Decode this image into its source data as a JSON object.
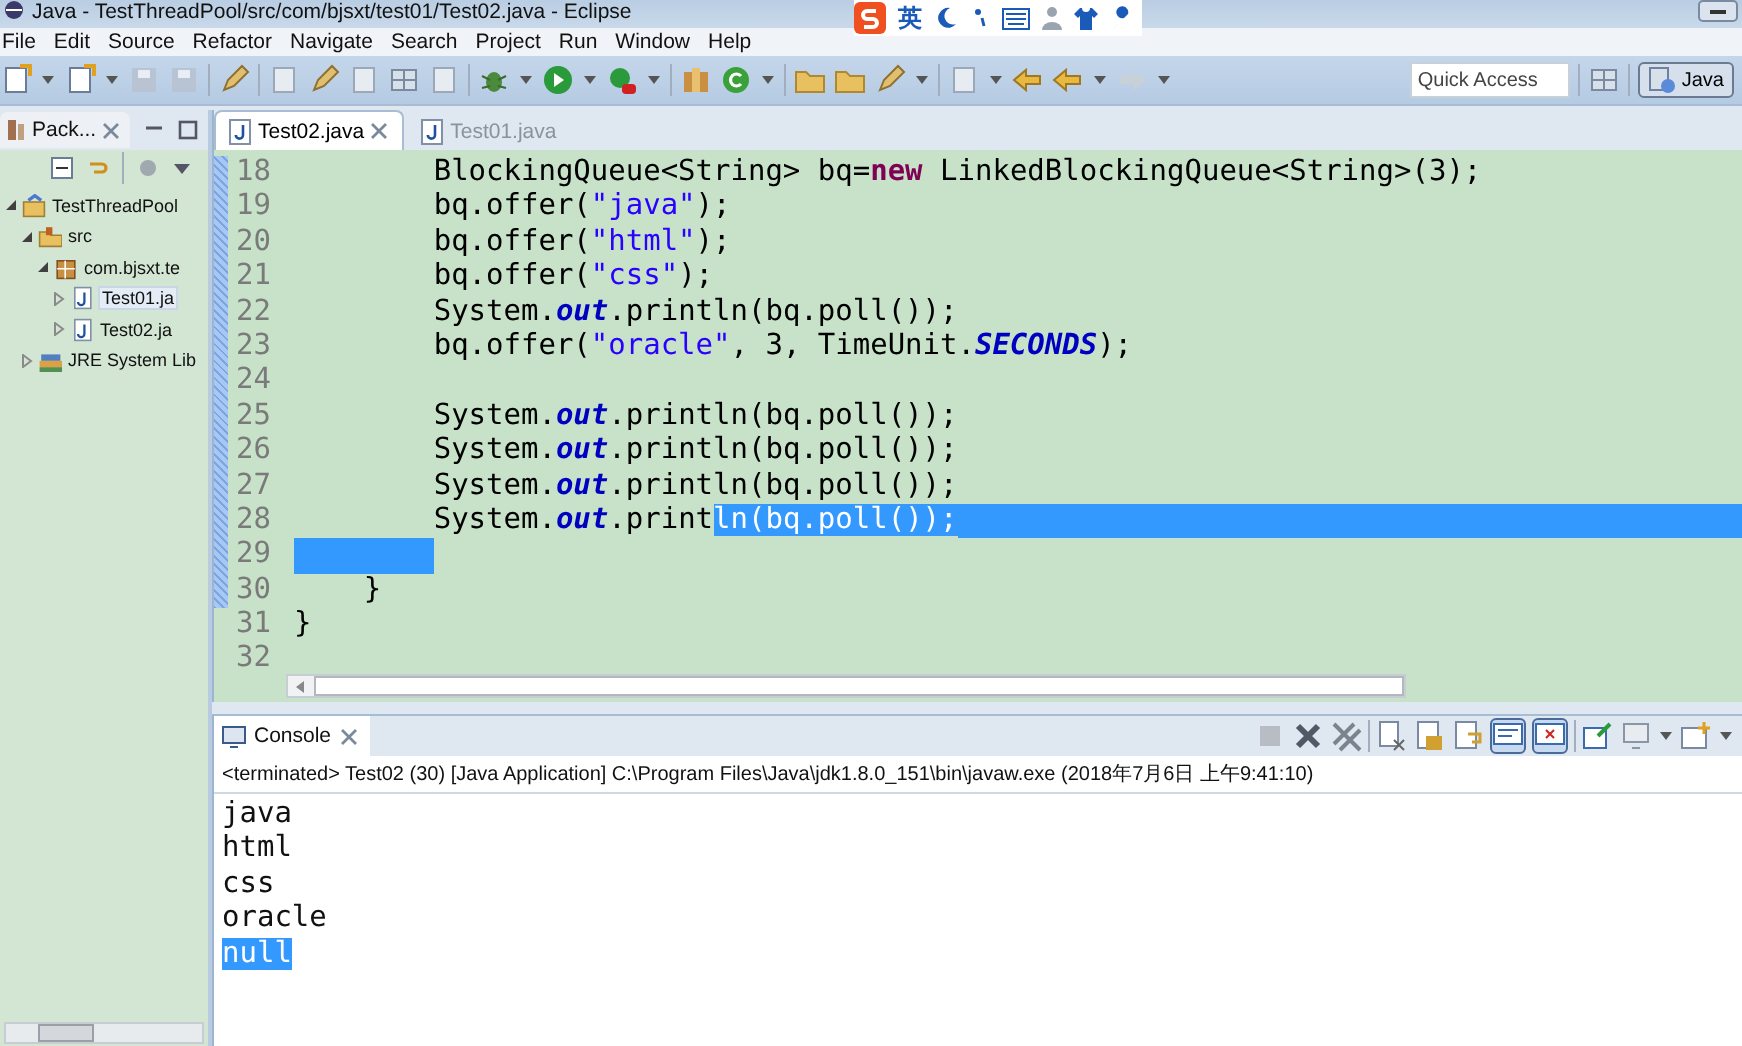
{
  "window": {
    "title": "Java - TestThreadPool/src/com/bjsxt/test01/Test02.java - Eclipse"
  },
  "ime_bar": {
    "label": "英"
  },
  "menu": [
    "File",
    "Edit",
    "Source",
    "Refactor",
    "Navigate",
    "Search",
    "Project",
    "Run",
    "Window",
    "Help"
  ],
  "quick_access": {
    "placeholder": "Quick Access"
  },
  "perspectives": [
    {
      "label": "Java",
      "selected": true
    }
  ],
  "package_explorer": {
    "title": "Pack...",
    "tree": [
      {
        "label": "TestThreadPool",
        "kind": "project",
        "expanded": true,
        "selected": false,
        "children": [
          {
            "label": "src",
            "kind": "source-folder",
            "expanded": true,
            "selected": false,
            "children": [
              {
                "label": "com.bjsxt.te",
                "kind": "package",
                "expanded": true,
                "selected": false,
                "children": [
                  {
                    "label": "Test01.ja",
                    "kind": "java-file",
                    "expanded": false,
                    "selected": true
                  },
                  {
                    "label": "Test02.ja",
                    "kind": "java-file",
                    "expanded": false,
                    "selected": false
                  }
                ]
              }
            ]
          },
          {
            "label": "JRE System Lib",
            "kind": "library",
            "expanded": false,
            "selected": false
          }
        ]
      }
    ]
  },
  "editor": {
    "tabs": [
      {
        "label": "Test02.java",
        "selected": true
      },
      {
        "label": "Test01.java",
        "selected": false
      }
    ],
    "lines": [
      {
        "number": "18",
        "tokens": [
          {
            "kind": "plain",
            "text": "        BlockingQueue<String> bq=",
            "selected": false
          },
          {
            "kind": "keyword",
            "text": "new",
            "selected": false
          },
          {
            "kind": "plain",
            "text": " LinkedBlockingQueue<String>(3);",
            "selected": false
          }
        ]
      },
      {
        "number": "19",
        "tokens": [
          {
            "kind": "plain",
            "text": "        bq.offer(",
            "selected": false
          },
          {
            "kind": "string",
            "text": "\"java\"",
            "selected": false
          },
          {
            "kind": "plain",
            "text": ");",
            "selected": false
          }
        ]
      },
      {
        "number": "20",
        "tokens": [
          {
            "kind": "plain",
            "text": "        bq.offer(",
            "selected": false
          },
          {
            "kind": "string",
            "text": "\"html\"",
            "selected": false
          },
          {
            "kind": "plain",
            "text": ");",
            "selected": false
          }
        ]
      },
      {
        "number": "21",
        "tokens": [
          {
            "kind": "plain",
            "text": "        bq.offer(",
            "selected": false
          },
          {
            "kind": "string",
            "text": "\"css\"",
            "selected": false
          },
          {
            "kind": "plain",
            "text": ");",
            "selected": false
          }
        ]
      },
      {
        "number": "22",
        "tokens": [
          {
            "kind": "plain",
            "text": "        System.",
            "selected": false
          },
          {
            "kind": "static",
            "text": "out",
            "selected": false
          },
          {
            "kind": "plain",
            "text": ".println(bq.poll());",
            "selected": false
          }
        ]
      },
      {
        "number": "23",
        "tokens": [
          {
            "kind": "plain",
            "text": "        bq.offer(",
            "selected": false
          },
          {
            "kind": "string",
            "text": "\"oracle\"",
            "selected": false
          },
          {
            "kind": "plain",
            "text": ", 3, TimeUnit.",
            "selected": false
          },
          {
            "kind": "static",
            "text": "SECONDS",
            "selected": false
          },
          {
            "kind": "plain",
            "text": ");",
            "selected": false
          }
        ]
      },
      {
        "number": "24"
      },
      {
        "number": "25",
        "tokens": [
          {
            "kind": "plain",
            "text": "        System.",
            "selected": false
          },
          {
            "kind": "static",
            "text": "out",
            "selected": false
          },
          {
            "kind": "plain",
            "text": ".println(bq.poll());",
            "selected": false
          }
        ]
      },
      {
        "number": "26",
        "tokens": [
          {
            "kind": "plain",
            "text": "        System.",
            "selected": false
          },
          {
            "kind": "static",
            "text": "out",
            "selected": false
          },
          {
            "kind": "plain",
            "text": ".println(bq.poll());",
            "selected": false
          }
        ]
      },
      {
        "number": "27",
        "tokens": [
          {
            "kind": "plain",
            "text": "        System.",
            "selected": false
          },
          {
            "kind": "static",
            "text": "out",
            "selected": false
          },
          {
            "kind": "plain",
            "text": ".println(bq.poll());",
            "selected": false
          }
        ]
      },
      {
        "number": "28",
        "selected_to_end": true,
        "tokens": [
          {
            "kind": "plain",
            "text": "        System.",
            "selected": false
          },
          {
            "kind": "static",
            "text": "out",
            "selected": false
          },
          {
            "kind": "plain",
            "text": ".print",
            "selected": false
          },
          {
            "kind": "plain",
            "text": "ln(bq.poll());",
            "selected": true
          }
        ]
      },
      {
        "number": "29",
        "leading_selection": true
      },
      {
        "number": "30",
        "tokens": [
          {
            "kind": "plain",
            "text": "    }",
            "selected": false
          }
        ]
      },
      {
        "number": "31",
        "tokens": [
          {
            "kind": "plain",
            "text": "}",
            "selected": false
          }
        ]
      },
      {
        "number": "32"
      }
    ]
  },
  "console": {
    "title": "Console",
    "info": "<terminated> Test02 (30) [Java Application] C:\\Program Files\\Java\\jdk1.8.0_151\\bin\\javaw.exe (2018年7月6日 上午9:41:10)",
    "output": [
      {
        "text": "java",
        "selected": false
      },
      {
        "text": "html",
        "selected": false
      },
      {
        "text": "css",
        "selected": false
      },
      {
        "text": "oracle",
        "selected": false
      },
      {
        "text": "null",
        "selected": true
      }
    ]
  }
}
